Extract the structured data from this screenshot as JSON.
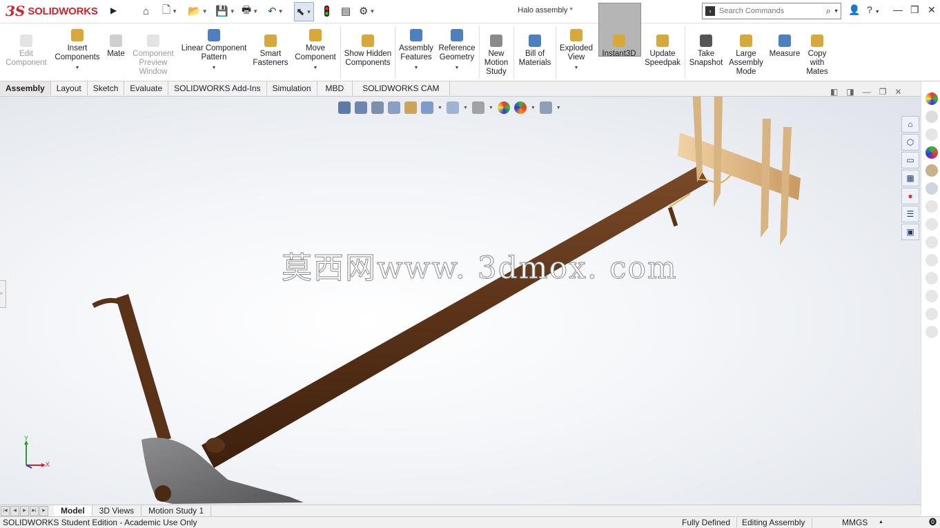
{
  "app": {
    "logo_prefix": "3S",
    "logo_text": "SOLIDWORKS",
    "document_title": "Halo assembly *"
  },
  "search": {
    "placeholder": "Search Commands"
  },
  "quick_access": [
    "home-icon",
    "new-document-icon",
    "open-icon",
    "save-icon",
    "print-icon",
    "undo-icon",
    "select-icon",
    "rebuild-icon",
    "file-properties-icon",
    "options-icon"
  ],
  "command_manager": {
    "tools": [
      {
        "id": "edit-component",
        "label": "Edit Component",
        "disabled": true
      },
      {
        "id": "insert-components",
        "label": "Insert Components"
      },
      {
        "id": "mate",
        "label": "Mate"
      },
      {
        "id": "component-preview-window",
        "label": "Component Preview Window",
        "disabled": true
      },
      {
        "id": "linear-component-pattern",
        "label": "Linear Component Pattern"
      },
      {
        "id": "smart-fasteners",
        "label": "Smart Fasteners"
      },
      {
        "id": "move-component",
        "label": "Move Component"
      },
      {
        "id": "show-hidden-components",
        "label": "Show Hidden Components"
      },
      {
        "id": "assembly-features",
        "label": "Assembly Features"
      },
      {
        "id": "reference-geometry",
        "label": "Reference Geometry"
      },
      {
        "id": "new-motion-study",
        "label": "New Motion Study"
      },
      {
        "id": "bill-of-materials",
        "label": "Bill of Materials"
      },
      {
        "id": "exploded-view",
        "label": "Exploded View"
      },
      {
        "id": "instant3d",
        "label": "Instant3D",
        "active": true
      },
      {
        "id": "update-speedpak",
        "label": "Update Speedpak"
      },
      {
        "id": "take-snapshot",
        "label": "Take Snapshot"
      },
      {
        "id": "large-assembly-mode",
        "label": "Large Assembly Mode"
      },
      {
        "id": "measure",
        "label": "Measure"
      },
      {
        "id": "copy-with-mates",
        "label": "Copy with Mates"
      }
    ]
  },
  "tabs": [
    "Assembly",
    "Layout",
    "Sketch",
    "Evaluate",
    "SOLIDWORKS Add-Ins",
    "Simulation",
    "MBD",
    "SOLIDWORKS CAM"
  ],
  "active_tab": "Assembly",
  "viewport": {
    "watermark": "莫西网www. 3dmox. com"
  },
  "triad": {
    "y": "Y",
    "x": "X"
  },
  "bottom_tabs": [
    "Model",
    "3D Views",
    "Motion Study 1"
  ],
  "active_bottom_tab": "Model",
  "status": {
    "edition": "SOLIDWORKS Student Edition - Academic Use Only",
    "state": "Fully Defined",
    "mode": "Editing Assembly",
    "units": "MMGS"
  },
  "colors": {
    "brand": "#d2232a",
    "active_tool_bg": "#b5b5b5",
    "wood_dark": "#5a3218",
    "wood_light": "#e4c08c",
    "steel": "#6f6f72"
  }
}
